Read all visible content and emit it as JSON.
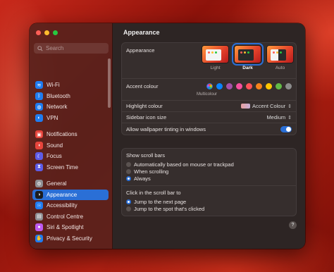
{
  "colors": {
    "accent_blue": "#2a6fd6",
    "close": "#ff5f57",
    "minimize": "#febc2e",
    "maximize": "#28c840"
  },
  "sidebar": {
    "search_placeholder": "Search",
    "groups": [
      [
        {
          "label": "Wi-Fi",
          "icon": "wifi-icon",
          "color": "#1f7cf0",
          "glyph": "≋"
        },
        {
          "label": "Bluetooth",
          "icon": "bluetooth-icon",
          "color": "#1f7cf0",
          "glyph": "ᛒ"
        },
        {
          "label": "Network",
          "icon": "network-icon",
          "color": "#1f7cf0",
          "glyph": "◍"
        },
        {
          "label": "VPN",
          "icon": "vpn-icon",
          "color": "#1f7cf0",
          "glyph": "◐"
        }
      ],
      [
        {
          "label": "Notifications",
          "icon": "notifications-icon",
          "color": "#e8453c",
          "glyph": "▣"
        },
        {
          "label": "Sound",
          "icon": "sound-icon",
          "color": "#e8453c",
          "glyph": "◖"
        },
        {
          "label": "Focus",
          "icon": "focus-icon",
          "color": "#5e5ce6",
          "glyph": "☾"
        },
        {
          "label": "Screen Time",
          "icon": "screen-time-icon",
          "color": "#5e5ce6",
          "glyph": "⧗"
        }
      ],
      [
        {
          "label": "General",
          "icon": "general-icon",
          "color": "#8e8e93",
          "glyph": "⚙"
        },
        {
          "label": "Appearance",
          "icon": "appearance-icon",
          "color": "#1c1c1e",
          "glyph": "◑",
          "selected": true
        },
        {
          "label": "Accessibility",
          "icon": "accessibility-icon",
          "color": "#1f7cf0",
          "glyph": "☉"
        },
        {
          "label": "Control Centre",
          "icon": "control-centre-icon",
          "color": "#8e8e93",
          "glyph": "▤"
        },
        {
          "label": "Siri & Spotlight",
          "icon": "siri-icon",
          "color": "#bf5af2",
          "glyph": "●"
        },
        {
          "label": "Privacy & Security",
          "icon": "privacy-icon",
          "color": "#1f7cf0",
          "glyph": "✋"
        }
      ]
    ]
  },
  "main": {
    "title": "Appearance",
    "appearance": {
      "label": "Appearance",
      "options": [
        {
          "label": "Light",
          "kind": "light",
          "selected": false
        },
        {
          "label": "Dark",
          "kind": "dark",
          "selected": true
        },
        {
          "label": "Auto",
          "kind": "auto",
          "selected": false
        }
      ]
    },
    "accent": {
      "label": "Accent colour",
      "multicolour_label": "Multicolour",
      "colors": [
        "multi",
        "#0a84ff",
        "#a550a7",
        "#f74f9e",
        "#ff5257",
        "#f7821b",
        "#ffc600",
        "#62ba46",
        "#8c8c8c"
      ]
    },
    "highlight": {
      "label": "Highlight colour",
      "value": "Accent Colour"
    },
    "icon_size": {
      "label": "Sidebar icon size",
      "value": "Medium"
    },
    "tinting": {
      "label": "Allow wallpaper tinting in windows",
      "enabled": true
    },
    "scroll_bars": {
      "title": "Show scroll bars",
      "options": [
        {
          "label": "Automatically based on mouse or trackpad",
          "selected": false
        },
        {
          "label": "When scrolling",
          "selected": false
        },
        {
          "label": "Always",
          "selected": true
        }
      ]
    },
    "click_scroll": {
      "title": "Click in the scroll bar to",
      "options": [
        {
          "label": "Jump to the next page",
          "selected": true
        },
        {
          "label": "Jump to the spot that's clicked",
          "selected": false
        }
      ]
    },
    "help_label": "?"
  }
}
